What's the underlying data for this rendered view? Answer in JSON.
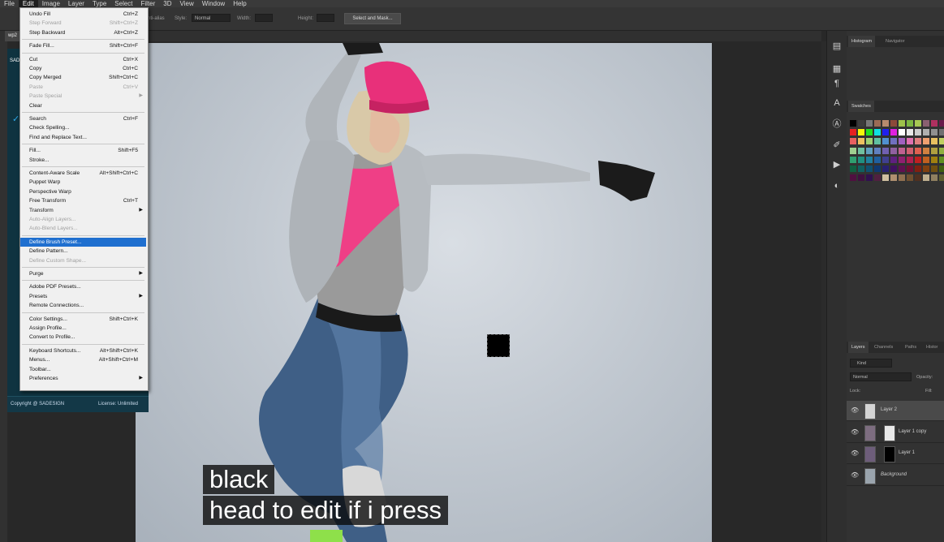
{
  "menubar": [
    "File",
    "Edit",
    "Image",
    "Layer",
    "Type",
    "Select",
    "Filter",
    "3D",
    "View",
    "Window",
    "Help"
  ],
  "options": {
    "antialias": "Anti-alias",
    "style_label": "Style:",
    "style_value": "Normal",
    "width_label": "Width:",
    "height_label": "Height:",
    "select_mask": "Select and Mask..."
  },
  "doc_tab": "wp2",
  "plugin": {
    "title": "SAD",
    "copyright": "Copyright @ SADESIGN",
    "license": "License: Unlimited"
  },
  "edit_menu": [
    {
      "label": "Undo Fill",
      "shortcut": "Ctrl+Z"
    },
    {
      "label": "Step Forward",
      "shortcut": "Shift+Ctrl+Z",
      "disabled": true
    },
    {
      "label": "Step Backward",
      "shortcut": "Alt+Ctrl+Z"
    },
    {
      "sep": true
    },
    {
      "label": "Fade Fill...",
      "shortcut": "Shift+Ctrl+F"
    },
    {
      "sep": true
    },
    {
      "label": "Cut",
      "shortcut": "Ctrl+X"
    },
    {
      "label": "Copy",
      "shortcut": "Ctrl+C"
    },
    {
      "label": "Copy Merged",
      "shortcut": "Shift+Ctrl+C"
    },
    {
      "label": "Paste",
      "shortcut": "Ctrl+V",
      "disabled": true
    },
    {
      "label": "Paste Special",
      "shortcut": "",
      "disabled": true,
      "submenu": true
    },
    {
      "label": "Clear",
      "shortcut": ""
    },
    {
      "sep": true
    },
    {
      "label": "Search",
      "shortcut": "Ctrl+F"
    },
    {
      "label": "Check Spelling...",
      "shortcut": ""
    },
    {
      "label": "Find and Replace Text...",
      "shortcut": ""
    },
    {
      "sep": true
    },
    {
      "label": "Fill...",
      "shortcut": "Shift+F5"
    },
    {
      "label": "Stroke...",
      "shortcut": ""
    },
    {
      "sep": true
    },
    {
      "label": "Content-Aware Scale",
      "shortcut": "Alt+Shift+Ctrl+C"
    },
    {
      "label": "Puppet Warp",
      "shortcut": ""
    },
    {
      "label": "Perspective Warp",
      "shortcut": ""
    },
    {
      "label": "Free Transform",
      "shortcut": "Ctrl+T"
    },
    {
      "label": "Transform",
      "shortcut": "",
      "submenu": true
    },
    {
      "label": "Auto-Align Layers...",
      "shortcut": "",
      "disabled": true
    },
    {
      "label": "Auto-Blend Layers...",
      "shortcut": "",
      "disabled": true
    },
    {
      "sep": true
    },
    {
      "label": "Define Brush Preset...",
      "shortcut": "",
      "highlighted": true
    },
    {
      "label": "Define Pattern...",
      "shortcut": ""
    },
    {
      "label": "Define Custom Shape...",
      "shortcut": "",
      "disabled": true
    },
    {
      "sep": true
    },
    {
      "label": "Purge",
      "shortcut": "",
      "submenu": true
    },
    {
      "sep": true
    },
    {
      "label": "Adobe PDF Presets...",
      "shortcut": ""
    },
    {
      "label": "Presets",
      "shortcut": "",
      "submenu": true
    },
    {
      "label": "Remote Connections...",
      "shortcut": ""
    },
    {
      "sep": true
    },
    {
      "label": "Color Settings...",
      "shortcut": "Shift+Ctrl+K"
    },
    {
      "label": "Assign Profile...",
      "shortcut": ""
    },
    {
      "label": "Convert to Profile...",
      "shortcut": ""
    },
    {
      "sep": true
    },
    {
      "label": "Keyboard Shortcuts...",
      "shortcut": "Alt+Shift+Ctrl+K"
    },
    {
      "label": "Menus...",
      "shortcut": "Alt+Shift+Ctrl+M"
    },
    {
      "label": "Toolbar...",
      "shortcut": ""
    },
    {
      "label": "Preferences",
      "shortcut": "",
      "submenu": true
    }
  ],
  "panels": {
    "histogram_tab": "Histogram",
    "navigator_tab": "Navigator",
    "swatches_tab": "Swatches",
    "layers_tabs": [
      "Layers",
      "Channels",
      "Paths",
      "Histor"
    ],
    "kind_label": "Kind",
    "blend_mode": "Normal",
    "opacity_label": "Opacity:",
    "lock_label": "Lock:",
    "fill_label": "Fill:"
  },
  "layers": [
    {
      "name": "Layer 2",
      "selected": true
    },
    {
      "name": "Layer 1 copy"
    },
    {
      "name": "Layer 1"
    },
    {
      "name": "Background",
      "italic": true
    }
  ],
  "subtitles": [
    "black",
    "head to edit if i press"
  ],
  "colors": {
    "menu_highlight": "#1f6fcf",
    "plugin_bg": "#0f3340",
    "beanie_pink": "#e8307a"
  }
}
